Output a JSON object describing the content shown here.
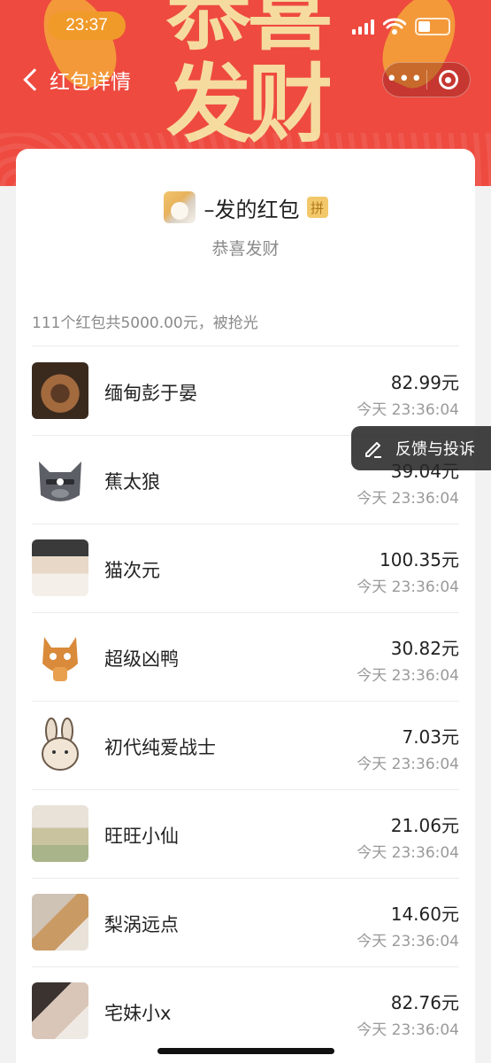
{
  "status_bar": {
    "time": "23:37"
  },
  "nav": {
    "back_label": "红包详情"
  },
  "header": {
    "banner_text": "恭喜发财"
  },
  "sender": {
    "name": "–发的红包",
    "badge": "拼",
    "greeting": "恭喜发财"
  },
  "summary": "111个红包共5000.00元，被抢光",
  "feedback": {
    "label": "反馈与投诉"
  },
  "rows": [
    {
      "name": "缅甸彭于晏",
      "amount": "82.99元",
      "time": "今天 23:36:04"
    },
    {
      "name": "蕉太狼",
      "amount": "39.04元",
      "time": "今天 23:36:04"
    },
    {
      "name": "猫次元",
      "amount": "100.35元",
      "time": "今天 23:36:04"
    },
    {
      "name": "超级凶鸭",
      "amount": "30.82元",
      "time": "今天 23:36:04"
    },
    {
      "name": "初代纯爱战士",
      "amount": "7.03元",
      "time": "今天 23:36:04"
    },
    {
      "name": "旺旺小仙",
      "amount": "21.06元",
      "time": "今天 23:36:04"
    },
    {
      "name": "梨涡远点",
      "amount": "14.60元",
      "time": "今天 23:36:04"
    },
    {
      "name": "宅妹小x",
      "amount": "82.76元",
      "time": "今天 23:36:04"
    }
  ],
  "colors": {
    "header_red": "#ee4a3f",
    "time_pill": "#f09a2a",
    "badge_gold": "#f2c86a"
  }
}
